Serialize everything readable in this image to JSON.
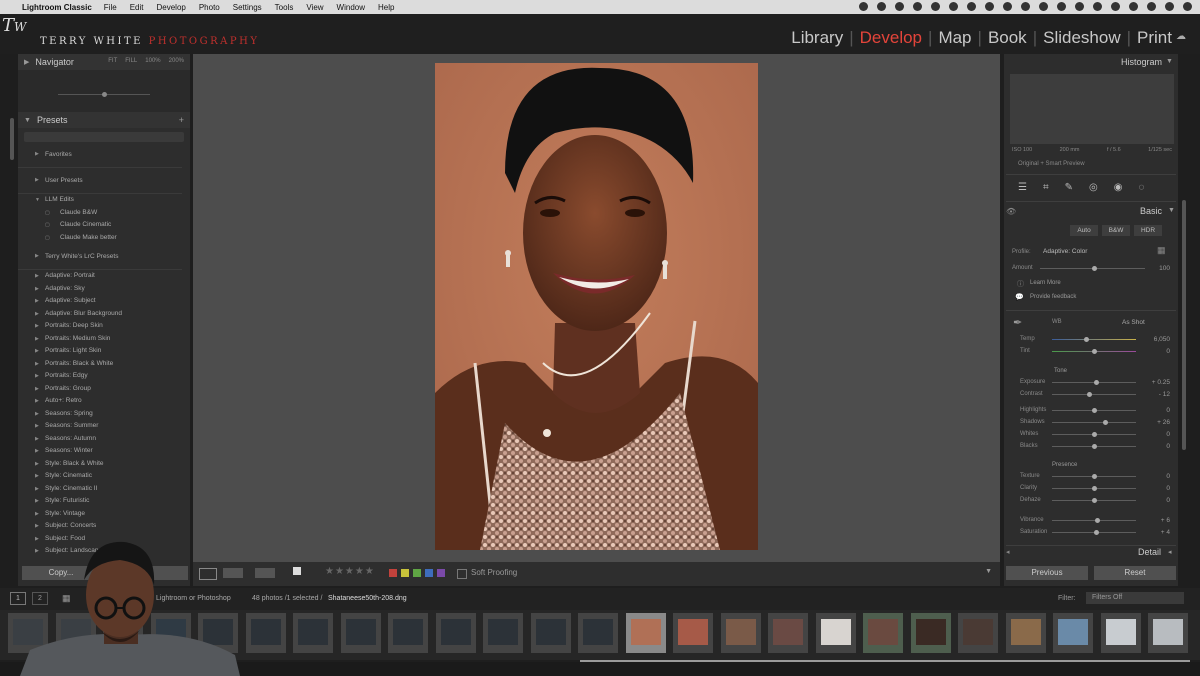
{
  "menubar": {
    "app_name": "Lightroom Classic",
    "items": [
      "File",
      "Edit",
      "Develop",
      "Photo",
      "Settings",
      "Tools",
      "View",
      "Window",
      "Help"
    ]
  },
  "identity": {
    "first": "Terry White",
    "second": "Photography"
  },
  "modules": [
    {
      "label": "Library",
      "active": false
    },
    {
      "label": "Develop",
      "active": true
    },
    {
      "label": "Map",
      "active": false
    },
    {
      "label": "Book",
      "active": false
    },
    {
      "label": "Slideshow",
      "active": false
    },
    {
      "label": "Print",
      "active": false
    }
  ],
  "left_panel": {
    "navigator_title": "Navigator",
    "navigator_zoom": [
      "FIT",
      "FILL",
      "100%",
      "200%"
    ],
    "presets_title": "Presets",
    "presets": [
      {
        "label": "Favorites",
        "type": "group"
      },
      {
        "label": "User Presets",
        "type": "group"
      },
      {
        "label": "LLM Edits",
        "type": "open"
      },
      {
        "label": "Claude B&W",
        "type": "child"
      },
      {
        "label": "Claude Cinematic",
        "type": "child"
      },
      {
        "label": "Claude Make better",
        "type": "child"
      },
      {
        "label": "Terry White's LrC Presets",
        "type": "group"
      },
      {
        "label": "Adaptive: Portrait",
        "type": "item"
      },
      {
        "label": "Adaptive: Sky",
        "type": "item"
      },
      {
        "label": "Adaptive: Subject",
        "type": "item"
      },
      {
        "label": "Adaptive: Blur Background",
        "type": "item"
      },
      {
        "label": "Portraits: Deep Skin",
        "type": "item"
      },
      {
        "label": "Portraits: Medium Skin",
        "type": "item"
      },
      {
        "label": "Portraits: Light Skin",
        "type": "item"
      },
      {
        "label": "Portraits: Black & White",
        "type": "item"
      },
      {
        "label": "Portraits: Edgy",
        "type": "item"
      },
      {
        "label": "Portraits: Group",
        "type": "item"
      },
      {
        "label": "Auto+: Retro",
        "type": "item"
      },
      {
        "label": "Seasons: Spring",
        "type": "item"
      },
      {
        "label": "Seasons: Summer",
        "type": "item"
      },
      {
        "label": "Seasons: Autumn",
        "type": "item"
      },
      {
        "label": "Seasons: Winter",
        "type": "item"
      },
      {
        "label": "Style: Black & White",
        "type": "item"
      },
      {
        "label": "Style: Cinematic",
        "type": "item"
      },
      {
        "label": "Style: Cinematic II",
        "type": "item"
      },
      {
        "label": "Style: Futuristic",
        "type": "item"
      },
      {
        "label": "Style: Vintage",
        "type": "item"
      },
      {
        "label": "Subject: Concerts",
        "type": "item"
      },
      {
        "label": "Subject: Food",
        "type": "item"
      },
      {
        "label": "Subject: Landscape",
        "type": "item"
      }
    ],
    "copy_label": "Copy..."
  },
  "toolbar": {
    "soft_proofing": "Soft Proofing",
    "colors": [
      "#c2423c",
      "#c7c23a",
      "#5fa544",
      "#3e6dbc",
      "#7a49a8"
    ]
  },
  "right_panel": {
    "histogram_title": "Histogram",
    "histogram_info": [
      "ISO 100",
      "200 mm",
      "f / 5.6",
      "1/125 sec"
    ],
    "original_label": "Original + Smart Preview",
    "basic_title": "Basic",
    "treatment": [
      "Auto",
      "B&W",
      "HDR"
    ],
    "profile_label": "Profile:",
    "profile_value": "Adaptive: Color",
    "amount_label": "Amount",
    "amount_value": "100",
    "learn_more": "Learn More",
    "feedback": "Provide feedback",
    "wb_label": "WB",
    "wb_value": "As Shot",
    "tone_title": "Tone",
    "presence_title": "Presence",
    "sliders": [
      {
        "label": "Temp",
        "value": "6,050",
        "pos": 0.4
      },
      {
        "label": "Tint",
        "value": "0",
        "pos": 0.5
      },
      {
        "label": "Exposure",
        "value": "+ 0.25",
        "pos": 0.52
      },
      {
        "label": "Contrast",
        "value": "- 12",
        "pos": 0.44
      },
      {
        "label": "Highlights",
        "value": "0",
        "pos": 0.5
      },
      {
        "label": "Shadows",
        "value": "+ 26",
        "pos": 0.63
      },
      {
        "label": "Whites",
        "value": "0",
        "pos": 0.5
      },
      {
        "label": "Blacks",
        "value": "0",
        "pos": 0.5
      },
      {
        "label": "Texture",
        "value": "0",
        "pos": 0.5
      },
      {
        "label": "Clarity",
        "value": "0",
        "pos": 0.5
      },
      {
        "label": "Dehaze",
        "value": "0",
        "pos": 0.5
      },
      {
        "label": "Vibrance",
        "value": "+ 6",
        "pos": 0.53
      },
      {
        "label": "Saturation",
        "value": "+ 4",
        "pos": 0.52
      }
    ],
    "detail_title": "Detail",
    "previous": "Previous",
    "reset": "Reset"
  },
  "filmbar": {
    "pages": [
      "1",
      "2"
    ],
    "source": "Lightroom or Photoshop",
    "count": "48 photos /1 selected /",
    "filename": "Shataneese50th-208.dng",
    "filter_label": "Filter:",
    "filter_value": "Filters Off"
  }
}
